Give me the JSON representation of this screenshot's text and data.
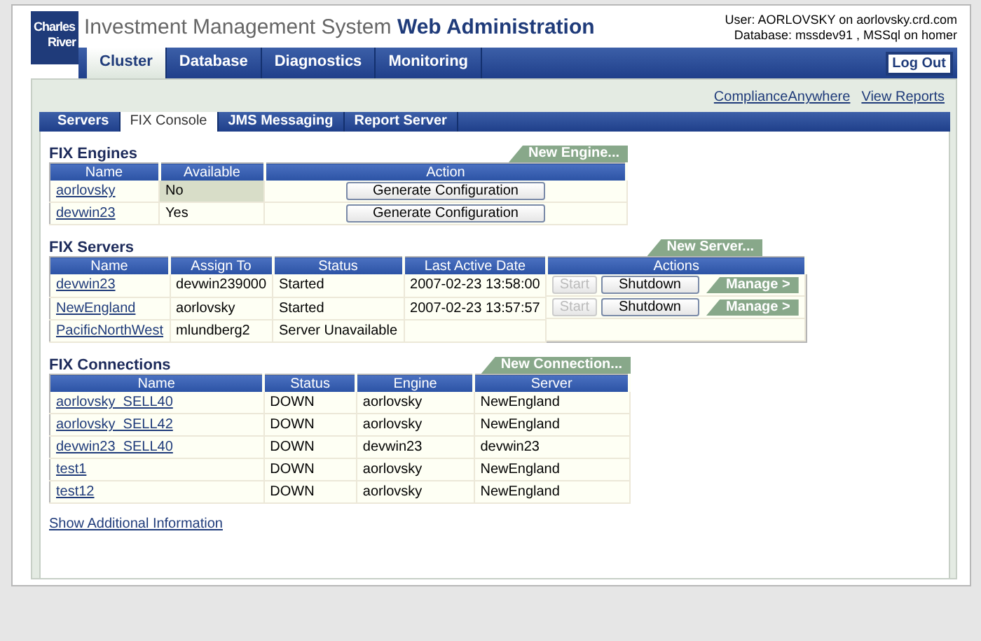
{
  "header": {
    "logo": [
      "Charles",
      "River"
    ],
    "title": "Investment Management System",
    "subtitle": "Web Administration",
    "user_info": "User: AORLOVSKY on aorlovsky.crd.com",
    "database_info": "Database: mssdev91 , MSSql on homer",
    "logout": "Log Out"
  },
  "main_tabs": [
    {
      "label": "Cluster",
      "selected": true
    },
    {
      "label": "Database",
      "selected": false
    },
    {
      "label": "Diagnostics",
      "selected": false
    },
    {
      "label": "Monitoring",
      "selected": false
    }
  ],
  "top_links": [
    "ComplianceAnywhere",
    "View Reports"
  ],
  "sub_tabs": [
    {
      "label": "Servers",
      "selected": false
    },
    {
      "label": "FIX Console",
      "selected": true
    },
    {
      "label": "JMS Messaging",
      "selected": false
    },
    {
      "label": "Report Server",
      "selected": false
    }
  ],
  "engines": {
    "title": "FIX Engines",
    "new_button": "New Engine...",
    "columns": [
      "Name",
      "Available",
      "Action"
    ],
    "rows": [
      {
        "name": "aorlovsky",
        "available": "No",
        "highlighted": true,
        "action": "Generate Configuration"
      },
      {
        "name": "devwin23",
        "available": "Yes",
        "highlighted": false,
        "action": "Generate Configuration"
      }
    ]
  },
  "servers": {
    "title": "FIX Servers",
    "new_button": "New Server...",
    "columns": [
      "Name",
      "Assign To",
      "Status",
      "Last Active Date",
      "Actions"
    ],
    "rows": [
      {
        "name": "devwin23",
        "assign_to": "devwin239000",
        "status": "Started",
        "last_active": "2007-02-23 13:58:00",
        "start": "Start",
        "start_disabled": true,
        "shutdown": "Shutdown",
        "manage": "Manage >"
      },
      {
        "name": "NewEngland",
        "assign_to": "aorlovsky",
        "status": "Started",
        "last_active": "2007-02-23 13:57:57",
        "start": "Start",
        "start_disabled": true,
        "shutdown": "Shutdown",
        "manage": "Manage >"
      },
      {
        "name": "PacificNorthWest",
        "assign_to": "mlundberg2",
        "status": "Server Unavailable"
      }
    ]
  },
  "connections": {
    "title": "FIX Connections",
    "new_button": "New Connection...",
    "columns": [
      "Name",
      "Status",
      "Engine",
      "Server"
    ],
    "rows": [
      {
        "name": "aorlovsky_SELL40",
        "status": "DOWN",
        "engine": "aorlovsky",
        "server": "NewEngland"
      },
      {
        "name": "aorlovsky_SELL42",
        "status": "DOWN",
        "engine": "aorlovsky",
        "server": "NewEngland"
      },
      {
        "name": "devwin23_SELL40",
        "status": "DOWN",
        "engine": "devwin23",
        "server": "devwin23"
      },
      {
        "name": "test1",
        "status": "DOWN",
        "engine": "aorlovsky",
        "server": "NewEngland"
      },
      {
        "name": "test12",
        "status": "DOWN",
        "engine": "aorlovsky",
        "server": "NewEngland"
      }
    ]
  },
  "footer_link": "Show Additional Information"
}
